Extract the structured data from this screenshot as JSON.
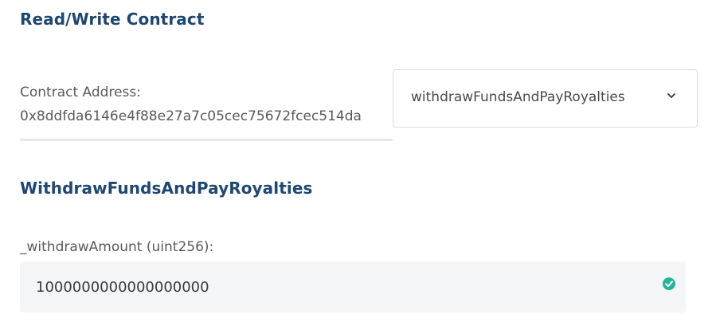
{
  "header": {
    "title": "Read/Write Contract"
  },
  "contract": {
    "address_label": "Contract Address:",
    "address_value": "0x8ddfda6146e4f88e27a7c05cec75672fcec514da"
  },
  "function_select": {
    "selected": "withdrawFundsAndPayRoyalties",
    "icon": "chevron-down-icon"
  },
  "function_panel": {
    "title": "WithdrawFundsAndPayRoyalties",
    "param_label": "_withdrawAmount (uint256):",
    "param_value": "1000000000000000000",
    "valid_icon": "check-circle-icon",
    "valid_color": "#27b399"
  },
  "colors": {
    "heading": "#1f4770",
    "accent_valid": "#27b399",
    "input_bg": "#f4f5f6"
  }
}
